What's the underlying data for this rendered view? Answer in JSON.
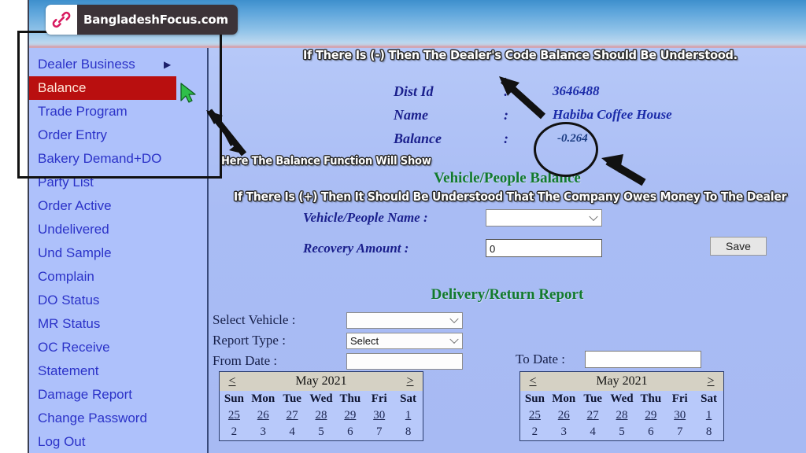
{
  "brand": {
    "name": "BangladeshFocus.com",
    "logo_icon": "link-chain-icon",
    "logo_color": "#d81b60",
    "badge_bg": "#3c3338"
  },
  "sidebar": {
    "items": [
      {
        "label": "Dealer Business",
        "has_submenu": true,
        "active": false
      },
      {
        "label": "Balance",
        "has_submenu": false,
        "active": true
      },
      {
        "label": "Trade Program",
        "has_submenu": false,
        "active": false
      },
      {
        "label": "Order Entry",
        "has_submenu": false,
        "active": false
      },
      {
        "label": "Bakery Demand+DO",
        "has_submenu": false,
        "active": false
      },
      {
        "label": "Party List",
        "has_submenu": false,
        "active": false
      },
      {
        "label": "Order Active",
        "has_submenu": false,
        "active": false
      },
      {
        "label": "Undelivered",
        "has_submenu": false,
        "active": false
      },
      {
        "label": "Und Sample",
        "has_submenu": false,
        "active": false
      },
      {
        "label": "Complain",
        "has_submenu": false,
        "active": false
      },
      {
        "label": "DO Status",
        "has_submenu": false,
        "active": false
      },
      {
        "label": "MR Status",
        "has_submenu": false,
        "active": false
      },
      {
        "label": "OC Receive",
        "has_submenu": false,
        "active": false
      },
      {
        "label": "Statement",
        "has_submenu": false,
        "active": false
      },
      {
        "label": "Damage Report",
        "has_submenu": false,
        "active": false
      },
      {
        "label": "Change Password",
        "has_submenu": false,
        "active": false
      },
      {
        "label": "Log Out",
        "has_submenu": false,
        "active": false
      }
    ],
    "active_bg": "#b90f0f",
    "link_color": "#2b32c8"
  },
  "annotations": {
    "top_caption": "If There Is (-) Then The Dealer's Code Balance Should Be Understood.",
    "mid_caption": "Here The Balance Function Will Show",
    "bottom_caption": "If There Is (+) Then It Should Be Understood That The Company Owes Money To The Dealer",
    "highlight_box": "menu-highlight-box",
    "highlight_circle": "balance-value-circle"
  },
  "dealer": {
    "rows": [
      {
        "label": "Dist Id",
        "colon": ":",
        "value": "3646488"
      },
      {
        "label": "Name",
        "colon": ":",
        "value": "Habiba Coffee House"
      },
      {
        "label": "Balance",
        "colon": ":",
        "value": "-0.264"
      }
    ]
  },
  "vehicle_people": {
    "title": "Vehicle/People Balance",
    "name_label": "Vehicle/People Name  :",
    "name_value": "",
    "amount_label": "Recovery Amount :",
    "amount_value": "0",
    "save_label": "Save"
  },
  "delivery_return": {
    "title": "Delivery/Return Report",
    "select_vehicle_label": "Select Vehicle :",
    "select_vehicle_value": "",
    "report_type_label": "Report Type :",
    "report_type_value": "Select",
    "from_date_label": "From Date :",
    "from_date_value": "",
    "to_date_label": "To Date :",
    "to_date_value": ""
  },
  "calendar": {
    "prev": "<",
    "next": ">",
    "title": "May 2021",
    "day_headers": [
      "Sun",
      "Mon",
      "Tue",
      "Wed",
      "Thu",
      "Fri",
      "Sat"
    ],
    "week_prev": [
      "25",
      "26",
      "27",
      "28",
      "29",
      "30",
      "1"
    ],
    "week_cur": [
      "2",
      "3",
      "4",
      "5",
      "6",
      "7",
      "8"
    ]
  },
  "cursor": {
    "name": "mouse-pointer",
    "color": "#2fbf4a"
  }
}
